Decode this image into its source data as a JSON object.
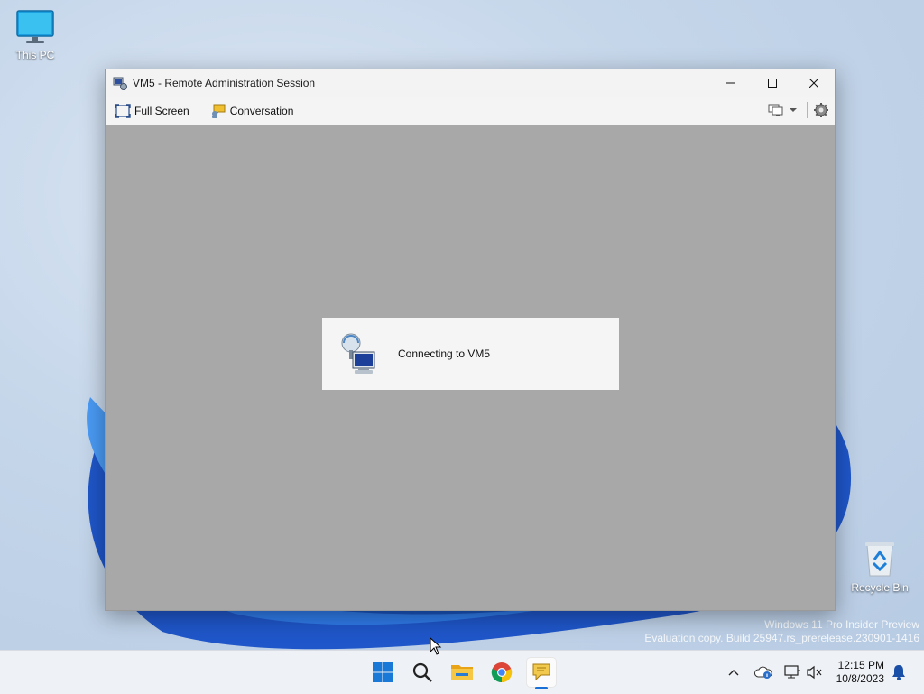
{
  "desktop": {
    "icons": [
      {
        "label": "This PC",
        "icon": "monitor-icon"
      },
      {
        "label": "Recycle Bin",
        "icon": "recycle-bin-icon"
      }
    ],
    "watermark": {
      "line1": "Windows 11 Pro Insider Preview",
      "line2": "Evaluation copy. Build 25947.rs_prerelease.230901-1416"
    }
  },
  "window": {
    "title": "VM5 - Remote Administration Session",
    "controls": {
      "minimize": "—",
      "maximize": "☐",
      "close": "✕"
    },
    "toolbar": {
      "full_screen": "Full Screen",
      "conversation": "Conversation"
    },
    "status": {
      "message": "Connecting to VM5"
    }
  },
  "taskbar": {
    "apps": [
      "start-icon",
      "search-icon",
      "file-explorer-icon",
      "chrome-icon",
      "remote-chat-icon"
    ],
    "time": "12:15 PM",
    "date": "10/8/2023"
  },
  "colors": {
    "accent": "#1a6fd6",
    "content_bg": "#a8a8a8",
    "taskbar_bg": "#eef1f6"
  }
}
